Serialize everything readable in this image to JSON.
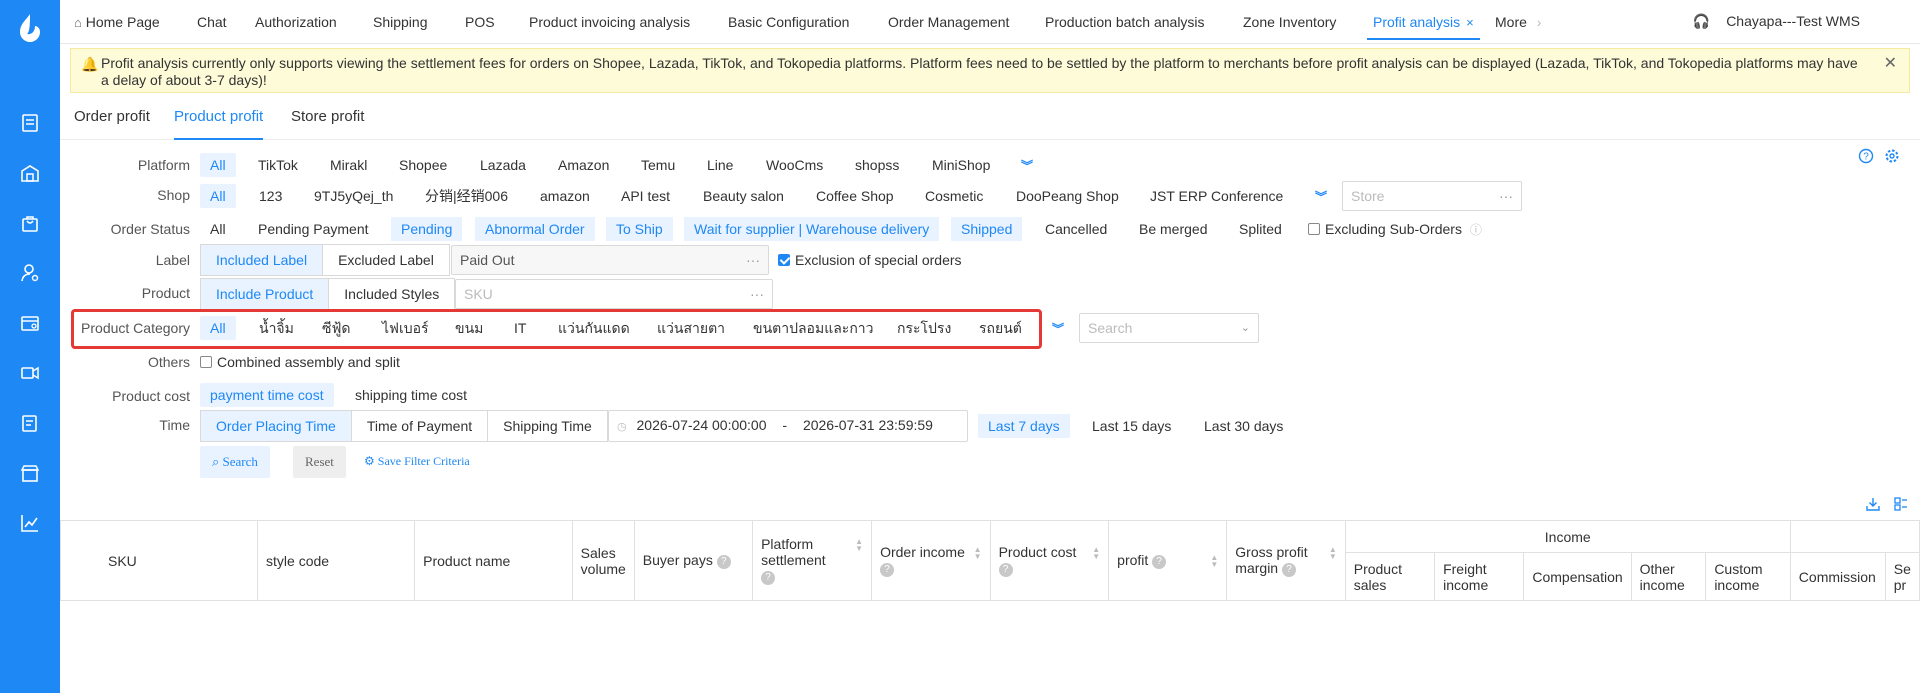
{
  "nav_tabs": [
    "Home Page",
    "Chat",
    "Authorization",
    "Shipping",
    "POS",
    "Product invoicing analysis",
    "Basic Configuration",
    "Order Management",
    "Production batch analysis",
    "Zone Inventory",
    "Profit analysis",
    "More"
  ],
  "active_tab_close": "×",
  "user": "Chayapa---Test WMS",
  "alert_text": "Profit analysis currently only supports viewing the settlement fees for orders on Shopee, Lazada, TikTok, and Tokopedia platforms. Platform fees need to be settled by the platform to merchants before profit analysis can be displayed (Lazada, TikTok, and Tokopedia platforms may have a delay of about 3-7 days)!",
  "sub_tabs": [
    "Order profit",
    "Product profit",
    "Store profit"
  ],
  "labels": {
    "platform": "Platform",
    "shop": "Shop",
    "order_status": "Order Status",
    "label": "Label",
    "product": "Product",
    "product_category": "Product Category",
    "others": "Others",
    "product_cost": "Product cost",
    "time": "Time"
  },
  "platforms": [
    "All",
    "TikTok",
    "Mirakl",
    "Shopee",
    "Lazada",
    "Amazon",
    "Temu",
    "Line",
    "WooCms",
    "shopss",
    "MiniShop"
  ],
  "shops": [
    "All",
    "123",
    "9TJ5yQej_th",
    "分销|经销006",
    "amazon",
    "API test",
    "Beauty salon",
    "Coffee Shop",
    "Cosmetic",
    "DooPeang Shop",
    "JST ERP Conference"
  ],
  "shop_placeholder": "Store",
  "order_statuses": [
    "All",
    "Pending Payment",
    "Pending",
    "Abnormal Order",
    "To Ship",
    "Wait for supplier | Warehouse delivery",
    "Shipped",
    "Cancelled",
    "Be merged",
    "Splited"
  ],
  "excluding_sub_orders": "Excluding Sub-Orders",
  "label_options": [
    "Included Label",
    "Excluded Label"
  ],
  "label_value": "Paid Out",
  "exclusion_special": "Exclusion of special orders",
  "product_options": [
    "Include Product",
    "Included Styles"
  ],
  "sku_placeholder": "SKU",
  "categories": [
    "All",
    "น้ำจิ้ม",
    "ซีฟู้ด",
    "ไฟเบอร์",
    "ขนม",
    "IT",
    "แว่นกันแดด",
    "แว่นสายตา",
    "ขนตาปลอมและกาว",
    "กระโปรง",
    "รถยนต์"
  ],
  "category_search_placeholder": "Search",
  "combined_assembly": "Combined assembly and split",
  "cost_options": [
    "payment time cost",
    "shipping time cost"
  ],
  "time_options": [
    "Order Placing Time",
    "Time of Payment",
    "Shipping Time"
  ],
  "date_start": "2026-07-24 00:00:00",
  "date_sep": "-",
  "date_end": "2026-07-31 23:59:59",
  "quick_ranges": [
    "Last 7 days",
    "Last 15 days",
    "Last 30 days"
  ],
  "buttons": {
    "search": "Search",
    "reset": "Reset",
    "save_filter": "Save Filter Criteria"
  },
  "table": {
    "columns": [
      "SKU",
      "style code",
      "Product name",
      "Sales volume",
      "Buyer pays",
      "Platform settlement",
      "Order income",
      "Product cost",
      "profit",
      "Gross profit margin"
    ],
    "income_group": "Income",
    "income_columns": [
      "Product sales",
      "Freight income",
      "Compensation",
      "Other income",
      "Custom income"
    ],
    "extra_columns": [
      "Commission",
      "Se pr"
    ]
  },
  "colors": {
    "accent": "#1e88f5",
    "sidebar": "#1e88f5",
    "alert_bg": "#fefbd8",
    "highlight_border": "#e53935"
  }
}
